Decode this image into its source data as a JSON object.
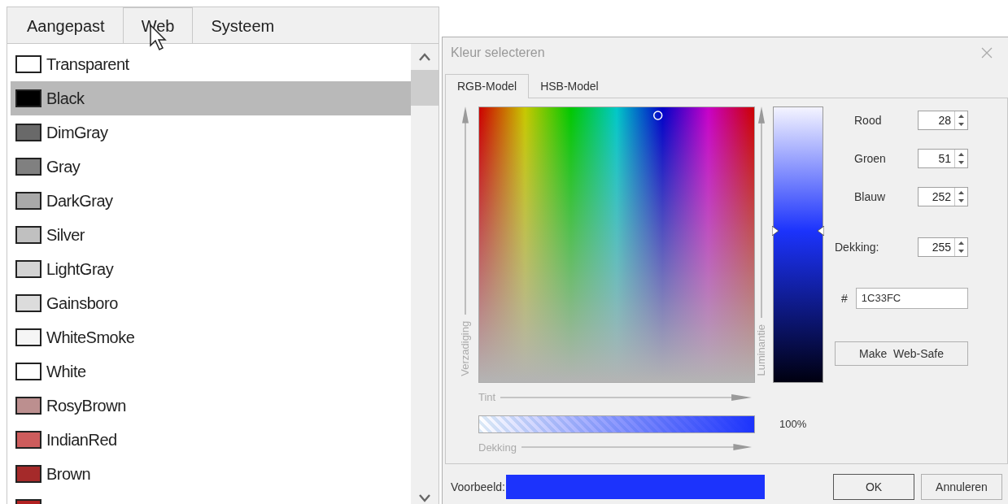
{
  "color_tabs": [
    {
      "label": "Aangepast",
      "selected": false
    },
    {
      "label": "Web",
      "selected": true
    },
    {
      "label": "Systeem",
      "selected": false
    }
  ],
  "colors": [
    {
      "name": "Transparent",
      "color": "#ffffff",
      "selected": false
    },
    {
      "name": "Black",
      "color": "#000000",
      "selected": true
    },
    {
      "name": "DimGray",
      "color": "#696969",
      "selected": false
    },
    {
      "name": "Gray",
      "color": "#808080",
      "selected": false
    },
    {
      "name": "DarkGray",
      "color": "#a9a9a9",
      "selected": false
    },
    {
      "name": "Silver",
      "color": "#c0c0c0",
      "selected": false
    },
    {
      "name": "LightGray",
      "color": "#d3d3d3",
      "selected": false
    },
    {
      "name": "Gainsboro",
      "color": "#dcdcdc",
      "selected": false
    },
    {
      "name": "WhiteSmoke",
      "color": "#f5f5f5",
      "selected": false
    },
    {
      "name": "White",
      "color": "#ffffff",
      "selected": false
    },
    {
      "name": "RosyBrown",
      "color": "#bc8f8f",
      "selected": false
    },
    {
      "name": "IndianRed",
      "color": "#cd5c5c",
      "selected": false
    },
    {
      "name": "Brown",
      "color": "#a52a2a",
      "selected": false
    },
    {
      "color": "#b22222",
      "selected": false
    }
  ],
  "dialog": {
    "title": "Kleur selecteren",
    "tabs": [
      {
        "label": "RGB-Model",
        "selected": true
      },
      {
        "label": "HSB-Model",
        "selected": false
      }
    ],
    "spectrum": {
      "level": 0.65,
      "y_label": "Verzadiging",
      "x_label": "Tint"
    },
    "opacity": {
      "label": "Dekking",
      "level": 1,
      "reading": "100%"
    },
    "luminance": {
      "label": "Luminantie",
      "level": 0.55
    },
    "fields": [
      {
        "label": "Rood",
        "value": "28"
      },
      {
        "label": "Groen",
        "value": "51"
      },
      {
        "label": "Blauw",
        "value": "252"
      },
      {
        "label": "Dekking:",
        "value": "255"
      }
    ],
    "hex": {
      "label": "#",
      "value": "1C33FC"
    },
    "web_safe_button": "Make  Web-Safe",
    "preview": {
      "label": "Voorbeeld:",
      "color": "#1c33fc"
    },
    "buttons": [
      "OK",
      "Annuleren"
    ]
  }
}
